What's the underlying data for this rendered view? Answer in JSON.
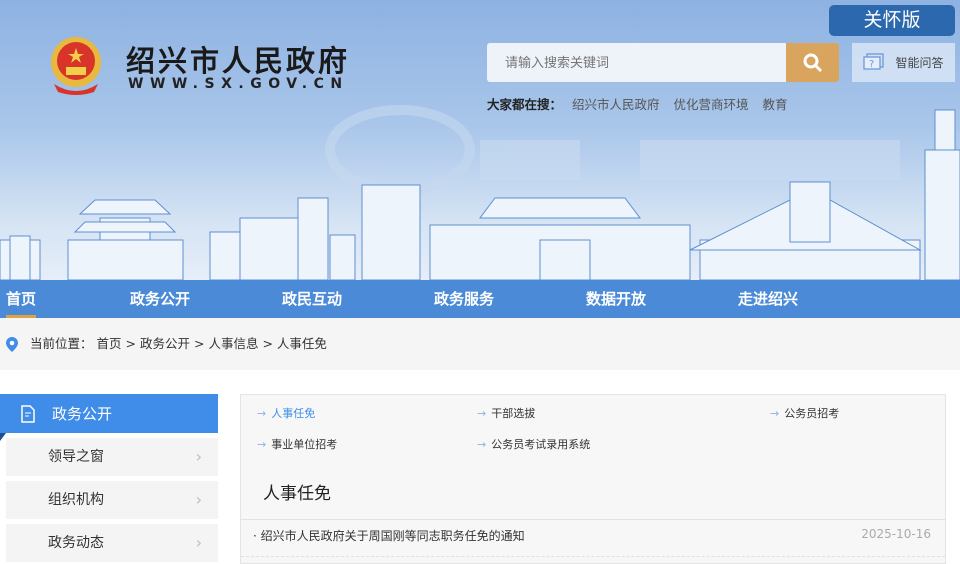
{
  "header": {
    "site_title": "绍兴市人民政府",
    "site_url": "WWW.SX.GOV.CN",
    "care_label": "关怀版",
    "search": {
      "placeholder": "请输入搜索关键词",
      "icon": "search-icon"
    },
    "qa_label": "智能问答",
    "hot": {
      "label": "大家都在搜：",
      "items": [
        "绍兴市人民政府",
        "优化营商环境",
        "教育"
      ]
    }
  },
  "nav": {
    "items": [
      "首页",
      "政务公开",
      "政民互动",
      "政务服务",
      "数据开放",
      "走进绍兴"
    ]
  },
  "breadcrumb": {
    "label": "当前位置：",
    "items": [
      "首页",
      "政务公开",
      "人事信息",
      "人事任免"
    ],
    "sep": ">"
  },
  "sidebar": {
    "title": "政务公开",
    "items": [
      "领导之窗",
      "组织机构",
      "政务动态"
    ]
  },
  "content": {
    "subnav": [
      "人事任免",
      "干部选拔",
      "公务员招考",
      "事业单位招考",
      "公务员考试录用系统"
    ],
    "title": "人事任免",
    "articles": [
      {
        "title": "绍兴市人民政府关于周国刚等同志职务任免的通知",
        "date": "2025-10-16"
      }
    ]
  },
  "colors": {
    "nav": "#4a8ad6",
    "accent": "#e0a343",
    "sidebar_active": "#3f8de8",
    "search_button": "#d9a45e",
    "care": "#2b68ae"
  }
}
